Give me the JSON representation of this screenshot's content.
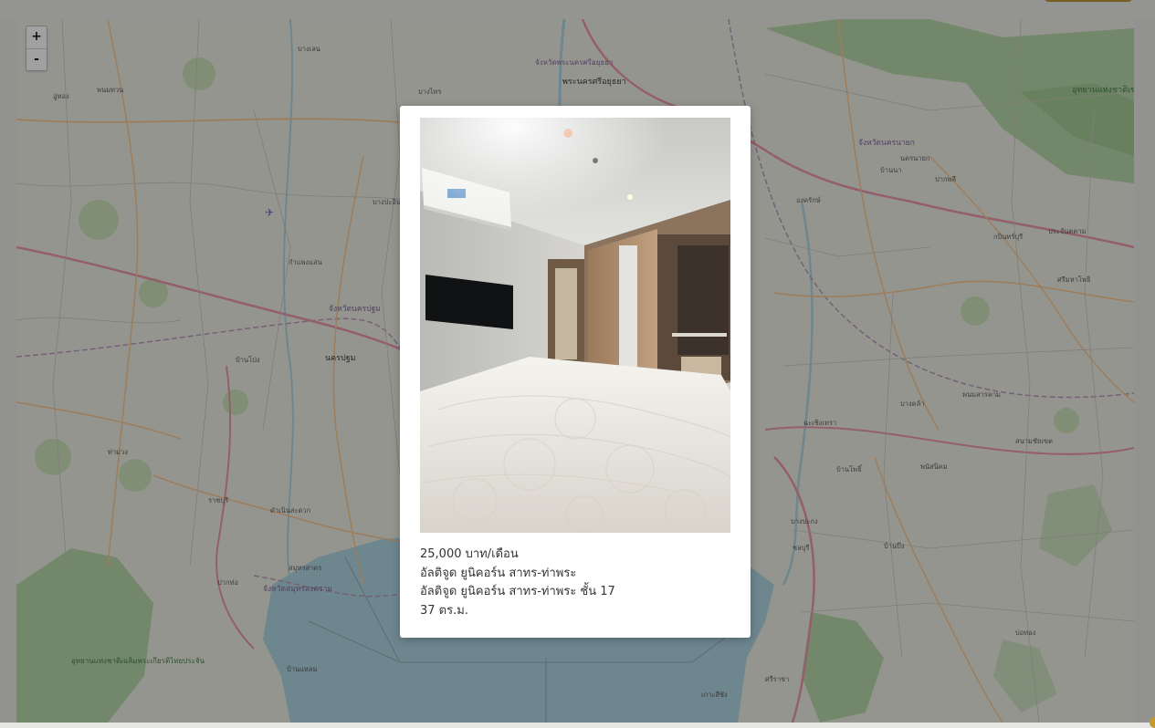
{
  "map": {
    "zoom_in": "+",
    "zoom_out": "-",
    "labels": [
      {
        "id": "ayutthaya_city",
        "text": "พระนครศรีอยุธยา"
      },
      {
        "id": "ayutthaya_prov",
        "text": "จังหวัดพระนครศรีอยุธยา"
      },
      {
        "id": "nakhon_pathom_prov",
        "text": "จังหวัดนครปฐม"
      },
      {
        "id": "nakhon_pathom_city",
        "text": "นครปฐม"
      },
      {
        "id": "samut_songkhram_prov",
        "text": "จังหวัดสมุทรสงคราม"
      },
      {
        "id": "nakhon_nayok_prov",
        "text": "จังหวัดนครนายก"
      },
      {
        "id": "khao_yai",
        "text": "อุทยานแห่งชาติเขาใหญ่"
      },
      {
        "id": "nakhon_nayok",
        "text": "นครนายก"
      },
      {
        "id": "pak_phli",
        "text": "ปากพลี"
      },
      {
        "id": "ban_na",
        "text": "บ้านนา"
      },
      {
        "id": "ongkharak",
        "text": "องครักษ์"
      },
      {
        "id": "bang_pa_in",
        "text": "บางปะอิน"
      },
      {
        "id": "u_thong",
        "text": "อู่ทอง"
      },
      {
        "id": "kamphaeng_saen",
        "text": "กำแพงแสน"
      },
      {
        "id": "ban_pong",
        "text": "บ้านโป่ง"
      },
      {
        "id": "ratchaburi",
        "text": "ราชบุรี"
      },
      {
        "id": "damnoen",
        "text": "ดำเนินสะดวก"
      },
      {
        "id": "samut_sakhon",
        "text": "สมุทรสาคร"
      },
      {
        "id": "chachoengsao",
        "text": "ฉะเชิงเทรา"
      },
      {
        "id": "phanom_sarakham",
        "text": "พนมสารคาม"
      },
      {
        "id": "bang_khla",
        "text": "บางคล้า"
      },
      {
        "id": "ban_pho",
        "text": "บ้านโพธิ์"
      },
      {
        "id": "bang_pakong",
        "text": "บางปะกง"
      },
      {
        "id": "phanat_nikhom",
        "text": "พนัสนิคม"
      },
      {
        "id": "ban_bueng",
        "text": "บ้านบึง"
      },
      {
        "id": "si_racha",
        "text": "ศรีราชา"
      },
      {
        "id": "chonburi",
        "text": "ชลบุรี"
      },
      {
        "id": "ko_si_chang",
        "text": "เกาะสีชัง"
      },
      {
        "id": "kaeng_krachan",
        "text": "อุทยานแห่งชาติเฉลิมพระเกียรติไทยประจัน"
      },
      {
        "id": "tha_muang",
        "text": "ท่าม่วง"
      },
      {
        "id": "phanom_thuan",
        "text": "พนมทวน"
      },
      {
        "id": "pak_tho",
        "text": "ปากท่อ"
      },
      {
        "id": "ban_laem",
        "text": "บ้านแหลม"
      },
      {
        "id": "bang_len",
        "text": "บางเลน"
      },
      {
        "id": "bang_sai",
        "text": "บางไทร"
      },
      {
        "id": "prachantakham",
        "text": "ประจันตคาม"
      },
      {
        "id": "si_mahosot",
        "text": "ศรีมหาโพธิ"
      },
      {
        "id": "kabin",
        "text": "กบินทร์บุรี"
      },
      {
        "id": "sanam_chai",
        "text": "สนามชัยเขต"
      },
      {
        "id": "bo_thong",
        "text": "บ่อทอง"
      }
    ]
  },
  "listing": {
    "price": "25,000 บาท/เดือน",
    "project": "อัลติจูด ยูนิคอร์น สาทร-ท่าพระ",
    "unit": "อัลติจูด ยูนิคอร์น สาทร-ท่าพระ ชั้น 17",
    "area": "37 ตร.ม."
  },
  "colors": {
    "accent": "#b98f2b",
    "map_land": "#ecebe3",
    "map_water": "#aad3df",
    "map_forest": "#add19e",
    "road_primary": "#e892a2",
    "road_secondary": "#f7c38b"
  }
}
